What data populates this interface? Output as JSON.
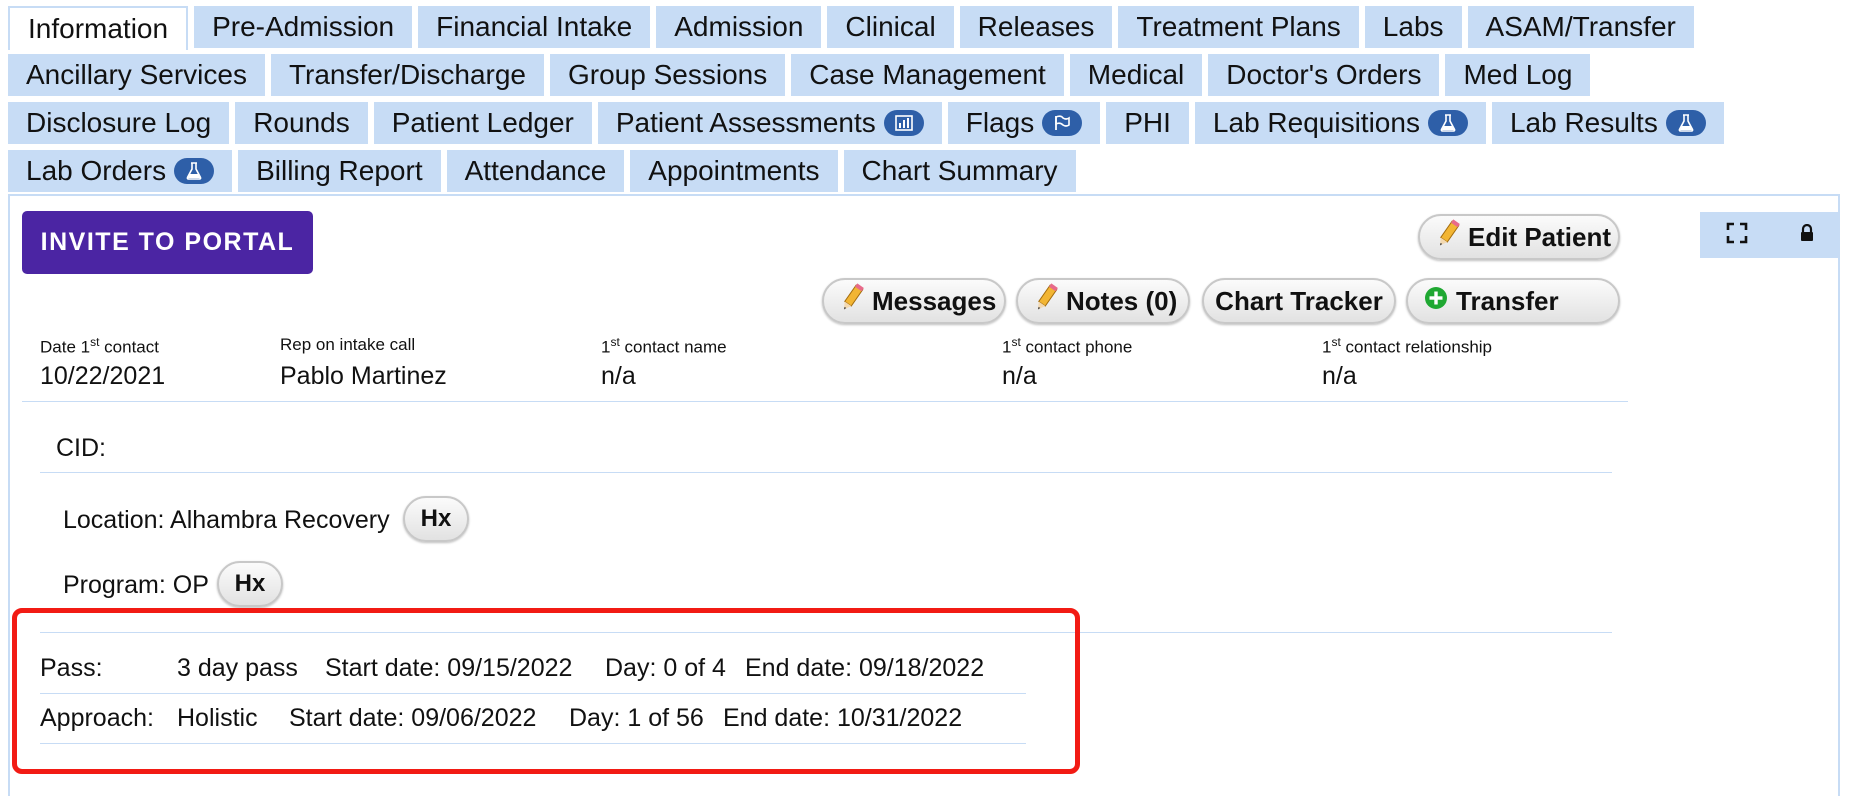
{
  "tabs": {
    "row1": [
      {
        "label": "Information",
        "active": true
      },
      {
        "label": "Pre-Admission"
      },
      {
        "label": "Financial Intake"
      },
      {
        "label": "Admission"
      },
      {
        "label": "Clinical"
      },
      {
        "label": "Releases"
      },
      {
        "label": "Treatment Plans"
      },
      {
        "label": "Labs"
      },
      {
        "label": "ASAM/Transfer"
      }
    ],
    "row2": [
      {
        "label": "Ancillary Services"
      },
      {
        "label": "Transfer/Discharge"
      },
      {
        "label": "Group Sessions"
      },
      {
        "label": "Case Management"
      },
      {
        "label": "Medical"
      },
      {
        "label": "Doctor's Orders"
      },
      {
        "label": "Med Log"
      }
    ],
    "row3": [
      {
        "label": "Disclosure Log"
      },
      {
        "label": "Rounds"
      },
      {
        "label": "Patient Ledger"
      },
      {
        "label": "Patient Assessments",
        "badge": "chart-icon"
      },
      {
        "label": "Flags",
        "badge": "flag-icon"
      },
      {
        "label": "PHI"
      },
      {
        "label": "Lab Requisitions",
        "badge": "flask-icon"
      },
      {
        "label": "Lab Results",
        "badge": "flask-icon"
      }
    ],
    "row4": [
      {
        "label": "Lab Orders",
        "badge": "flask-icon"
      },
      {
        "label": "Billing Report"
      },
      {
        "label": "Attendance"
      },
      {
        "label": "Appointments"
      },
      {
        "label": "Chart Summary"
      }
    ]
  },
  "actions": {
    "invite": "INVITE TO PORTAL",
    "edit_patient": "Edit Patient",
    "messages": "Messages",
    "notes": "Notes (0)",
    "chart_tracker": "Chart Tracker",
    "transfer": "Transfer"
  },
  "contact": {
    "date_label_pre": "Date 1",
    "date_label_sup": "st",
    "date_label_post": " contact",
    "date_value": "10/22/2021",
    "rep_label": "Rep on intake call",
    "rep_value": "Pablo Martinez",
    "name_label_pre": "1",
    "name_label_sup": "st",
    "name_label_post": " contact name",
    "name_value": "n/a",
    "phone_label_pre": "1",
    "phone_label_sup": "st",
    "phone_label_post": " contact phone",
    "phone_value": "n/a",
    "rel_label_pre": "1",
    "rel_label_sup": "st",
    "rel_label_post": " contact relationship",
    "rel_value": "n/a"
  },
  "patient": {
    "cid_label": "CID:",
    "location_label": "Location:",
    "location_value": "Alhambra Recovery",
    "program_label": "Program:",
    "program_value": "OP",
    "hx_label": "Hx"
  },
  "pass": {
    "label": "Pass:",
    "type": "3 day pass",
    "start": "Start date: 09/15/2022",
    "day": "Day: 0 of 4",
    "end": "End date: 09/18/2022"
  },
  "approach": {
    "label": "Approach:",
    "type": "Holistic",
    "start": "Start date: 09/06/2022",
    "day": "Day: 1 of 56",
    "end": "End date: 10/31/2022"
  },
  "colors": {
    "tab_bg": "#c7dcf5",
    "invite_bg": "#4b25a3",
    "badge_bg": "#2e5fa8",
    "highlight": "#f21b14"
  }
}
